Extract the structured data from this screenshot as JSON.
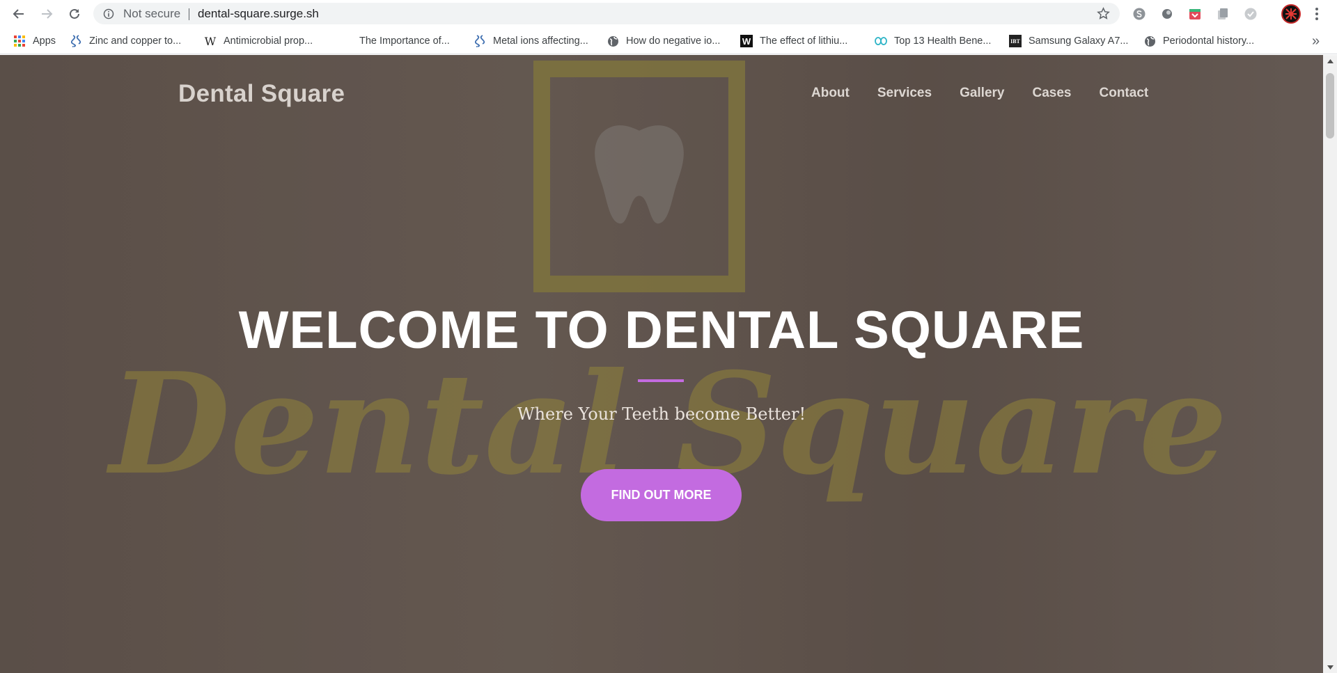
{
  "browser": {
    "security_label": "Not secure",
    "url": "dental-square.surge.sh",
    "bookmarks": [
      {
        "label": "Apps",
        "icon": "apps-grid-icon"
      },
      {
        "label": "Zinc and copper to...",
        "icon": "dna-icon"
      },
      {
        "label": "Antimicrobial prop...",
        "icon": "wikipedia-icon"
      },
      {
        "label": "The Importance of...",
        "icon": "blank-page-icon"
      },
      {
        "label": "Metal ions affecting...",
        "icon": "dna-icon"
      },
      {
        "label": "How do negative io...",
        "icon": "globe-icon"
      },
      {
        "label": "The effect of lithiu...",
        "icon": "w-logo-icon"
      },
      {
        "label": "Top 13 Health Bene...",
        "icon": "leaf-icon"
      },
      {
        "label": "Samsung Galaxy A7...",
        "icon": "ibt-icon"
      },
      {
        "label": "Periodontal history...",
        "icon": "globe-icon"
      }
    ],
    "ibt_text": "IBT",
    "more_label": "»"
  },
  "site": {
    "brand": "Dental Square",
    "nav": [
      "About",
      "Services",
      "Gallery",
      "Cases",
      "Contact"
    ],
    "headline": "WELCOME TO DENTAL SQUARE",
    "tagline": "Where Your Teeth become Better!",
    "cta": "FIND OUT MORE",
    "background_sign_text": "Dental Square",
    "accent_color": "#c36be0"
  }
}
